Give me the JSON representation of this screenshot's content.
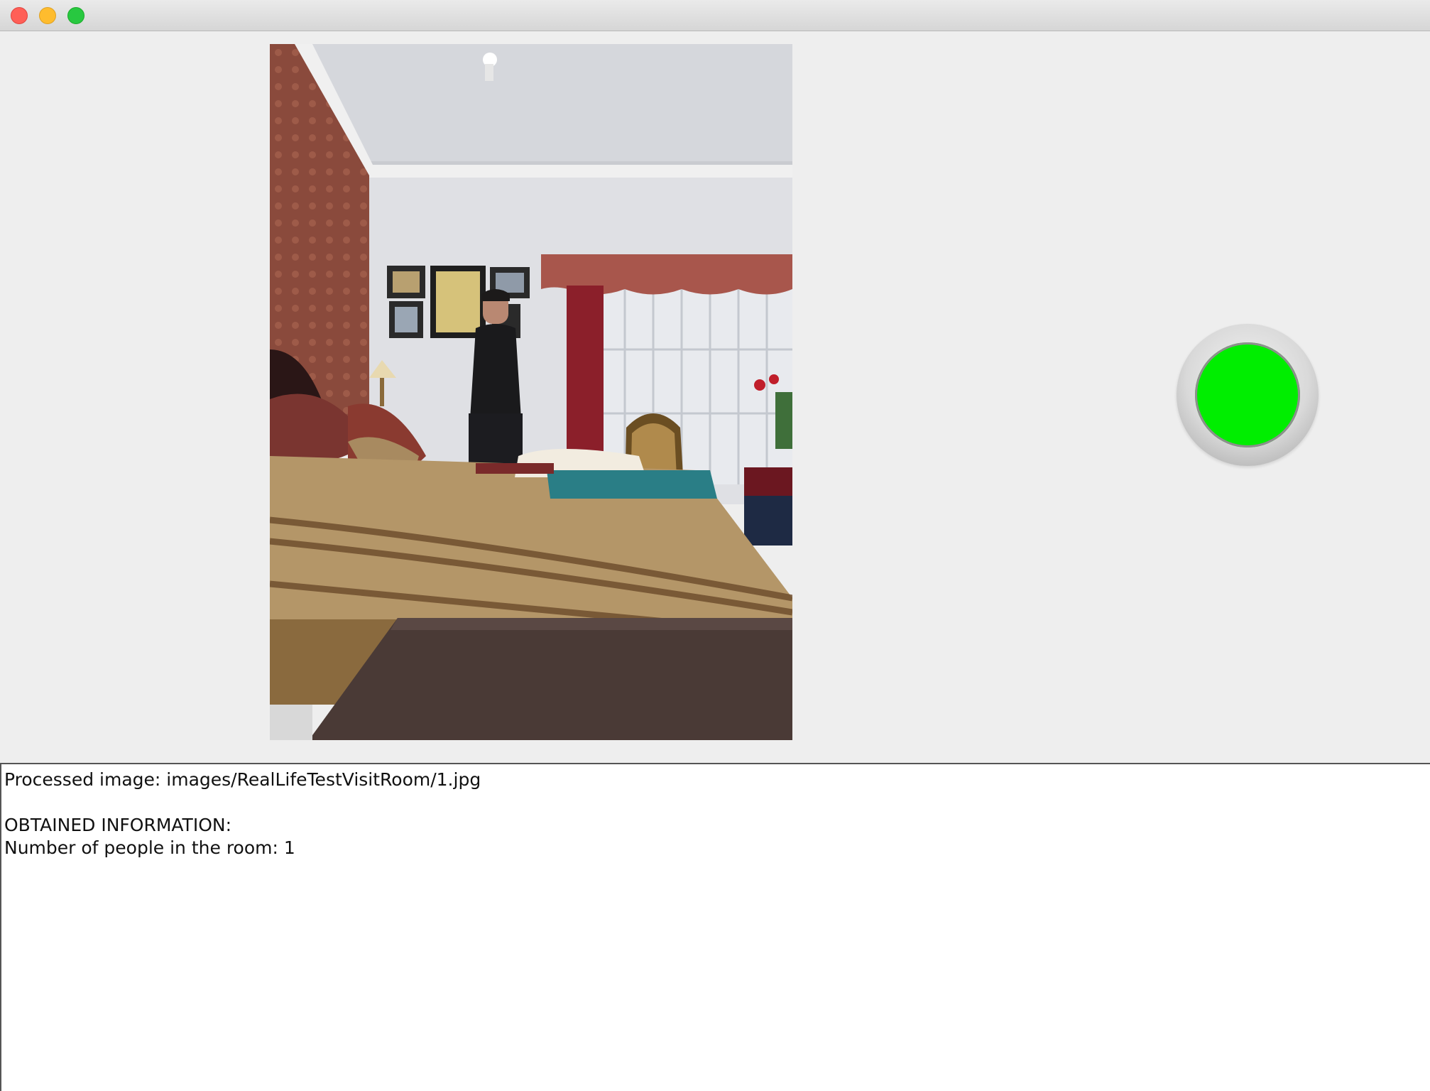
{
  "window": {
    "buttons": [
      "close",
      "minimize",
      "zoom"
    ]
  },
  "image_view": {
    "alt": "Bedroom photo with one person standing behind a bed"
  },
  "indicator": {
    "color": "#00ee00",
    "state": "green"
  },
  "console": {
    "line1": "Processed image: images/RealLifeTestVisitRoom/1.jpg",
    "line2": "",
    "line3": "OBTAINED INFORMATION:",
    "line4": "Number of people in the room: 1"
  }
}
